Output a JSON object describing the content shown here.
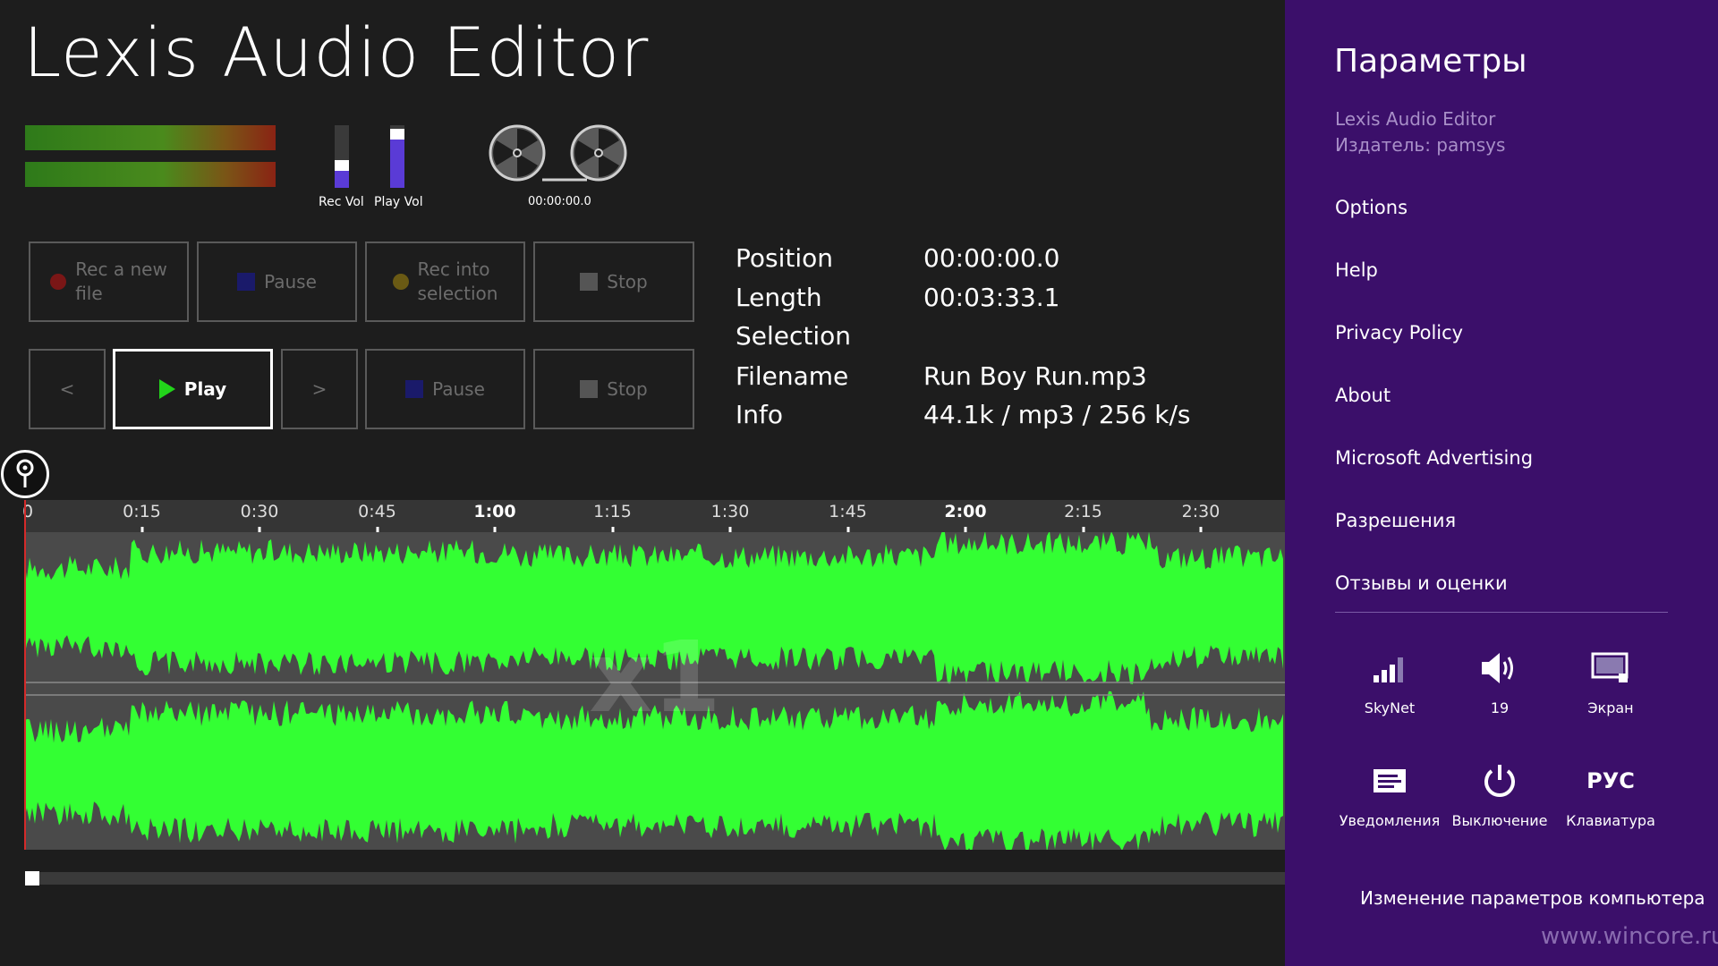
{
  "app": {
    "title": "Lexis Audio Editor"
  },
  "volumes": {
    "rec": {
      "label": "Rec Vol",
      "level": 0.35,
      "knob": 0.45
    },
    "play": {
      "label": "Play Vol",
      "level": 0.8,
      "knob": 0.95
    }
  },
  "transport_time": "00:00:00.0",
  "record_buttons": {
    "rec_new": {
      "line1": "Rec a new",
      "line2": "file",
      "color": "#7a1616"
    },
    "pause": {
      "label": "Pause",
      "color": "#1a1a6a"
    },
    "rec_selection": {
      "line1": "Rec into",
      "line2": "selection",
      "color": "#6a5a14"
    },
    "stop": {
      "label": "Stop"
    }
  },
  "play_buttons": {
    "prev": "<",
    "play": "Play",
    "next": ">",
    "pause": "Pause",
    "stop": "Stop"
  },
  "info": {
    "position": {
      "key": "Position",
      "value": "00:00:00.0"
    },
    "length": {
      "key": "Length",
      "value": "00:03:33.1"
    },
    "selection": {
      "key": "Selection",
      "value": ""
    },
    "filename": {
      "key": "Filename",
      "value": "Run Boy Run.mp3"
    },
    "info": {
      "key": "Info",
      "value": "44.1k / mp3 / 256 k/s"
    }
  },
  "timeline": {
    "ticks": [
      "0",
      "0:15",
      "0:30",
      "0:45",
      "1:00",
      "1:15",
      "1:30",
      "1:45",
      "2:00",
      "2:15",
      "2:30"
    ],
    "major": [
      "1:00",
      "2:00"
    ],
    "zoom_label": "x1"
  },
  "waveform": {
    "color": "#33ff33",
    "background": "#4a4a4a"
  },
  "panel": {
    "title": "Параметры",
    "app_name": "Lexis Audio Editor",
    "publisher": "Издатель: pamsys",
    "menu": [
      "Options",
      "Help",
      "Privacy Policy",
      "About",
      "Microsoft Advertising",
      "Разрешения",
      "Отзывы и оценки"
    ],
    "tiles": {
      "network": "SkyNet",
      "volume": "19",
      "screen": "Экран",
      "notifications": "Уведомления",
      "power": "Выключение",
      "keyboard_glyph": "РУС",
      "keyboard": "Клавиатура"
    },
    "change_settings": "Изменение параметров компьютера",
    "watermark": "www.wincore.ru"
  }
}
